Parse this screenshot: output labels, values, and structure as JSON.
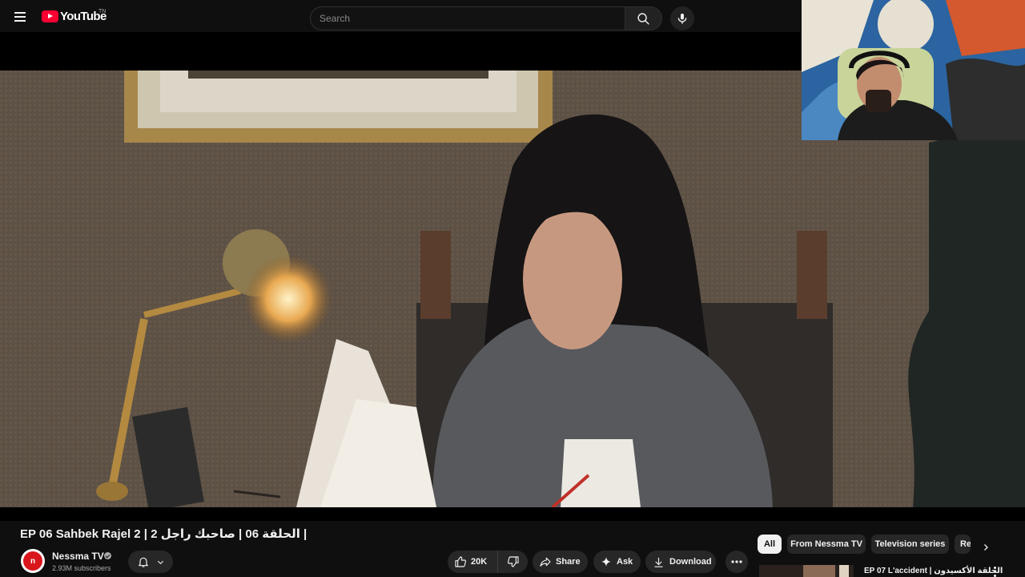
{
  "header": {
    "logo_text": "YouTube",
    "logo_superscript": "TN",
    "search_placeholder": "Search"
  },
  "video": {
    "title": "EP 06 Sahbek Rajel 2 | الحلقة 06 | صاحبك راجل 2 |"
  },
  "channel": {
    "name": "Nessma TV",
    "subscribers": "2.93M subscribers",
    "avatar_text": "n",
    "brand_color": "#d9161c"
  },
  "actions": {
    "like_count": "20K",
    "share_label": "Share",
    "ask_label": "Ask",
    "download_label": "Download"
  },
  "chips": [
    {
      "label": "All",
      "active": true
    },
    {
      "label": "From Nessma TV",
      "active": false
    },
    {
      "label": "Television series",
      "active": false
    },
    {
      "label": "Re",
      "active": false
    }
  ],
  "recommendation": {
    "title": "EP 07 L'accident | الحلقة الأكسيدون"
  },
  "colors": {
    "background": "#0f0f0f",
    "pill": "#272727",
    "accent_red": "#ff0033"
  }
}
